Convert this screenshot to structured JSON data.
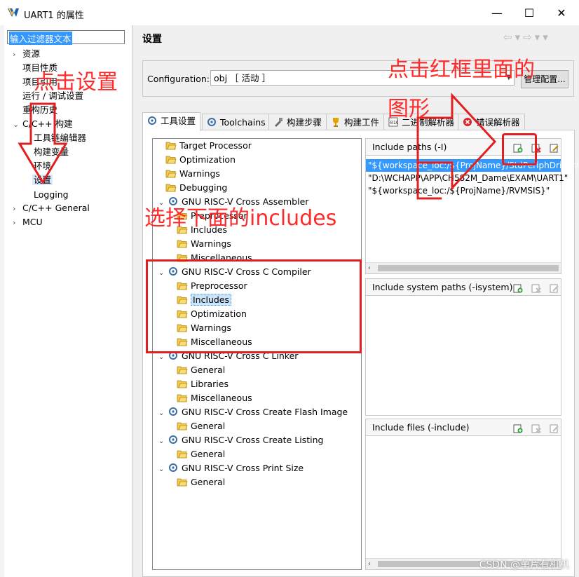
{
  "window": {
    "title": "UART1 的属性",
    "minimize": "—",
    "maximize": "☐",
    "close": "✕"
  },
  "filter": {
    "value": "输入过滤器文本"
  },
  "nav": [
    {
      "label": "资源",
      "arrow": "›"
    },
    {
      "label": "项目性质",
      "arrow": ""
    },
    {
      "label": "项目引用",
      "arrow": ""
    },
    {
      "label": "运行 / 调试设置",
      "arrow": ""
    },
    {
      "label": "重构历史",
      "arrow": ""
    },
    {
      "label": "C/C++ 构建",
      "arrow": "⌄"
    },
    {
      "label": "工具链编辑器",
      "arrow": ""
    },
    {
      "label": "构建变量",
      "arrow": ""
    },
    {
      "label": "环境",
      "arrow": ""
    },
    {
      "label": "设置",
      "arrow": ""
    },
    {
      "label": "Logging",
      "arrow": ""
    },
    {
      "label": "C/C++ General",
      "arrow": "›"
    },
    {
      "label": "MCU",
      "arrow": "›"
    }
  ],
  "header": {
    "title": "设置",
    "nav_arrows": "⇦▾⇨▾▾"
  },
  "config": {
    "label": "Configuration:",
    "value": "obj ［ 活动 ］",
    "manage_button": "管理配置..."
  },
  "tabs": [
    "工具设置",
    "Toolchains",
    "构建步骤",
    "构建工件",
    "二进制解析器",
    "错误解析器"
  ],
  "tree": [
    {
      "label": "Target Processor",
      "level": 1,
      "type": "folder"
    },
    {
      "label": "Optimization",
      "level": 1,
      "type": "folder"
    },
    {
      "label": "Warnings",
      "level": 1,
      "type": "folder"
    },
    {
      "label": "Debugging",
      "level": 1,
      "type": "folder"
    },
    {
      "label": "GNU RISC-V Cross Assembler",
      "level": 0,
      "type": "tool"
    },
    {
      "label": "Preprocessor",
      "level": 2,
      "type": "folder"
    },
    {
      "label": "Includes",
      "level": 2,
      "type": "folder"
    },
    {
      "label": "Warnings",
      "level": 2,
      "type": "folder"
    },
    {
      "label": "Miscellaneous",
      "level": 2,
      "type": "folder"
    },
    {
      "label": "GNU RISC-V Cross C Compiler",
      "level": 0,
      "type": "tool"
    },
    {
      "label": "Preprocessor",
      "level": 2,
      "type": "folder"
    },
    {
      "label": "Includes",
      "level": 2,
      "type": "folder",
      "selected": true
    },
    {
      "label": "Optimization",
      "level": 2,
      "type": "folder"
    },
    {
      "label": "Warnings",
      "level": 2,
      "type": "folder"
    },
    {
      "label": "Miscellaneous",
      "level": 2,
      "type": "folder"
    },
    {
      "label": "GNU RISC-V Cross C Linker",
      "level": 0,
      "type": "tool"
    },
    {
      "label": "General",
      "level": 2,
      "type": "folder"
    },
    {
      "label": "Libraries",
      "level": 2,
      "type": "folder"
    },
    {
      "label": "Miscellaneous",
      "level": 2,
      "type": "folder"
    },
    {
      "label": "GNU RISC-V Cross Create Flash Image",
      "level": 0,
      "type": "tool"
    },
    {
      "label": "General",
      "level": 2,
      "type": "folder"
    },
    {
      "label": "GNU RISC-V Cross Create Listing",
      "level": 0,
      "type": "tool"
    },
    {
      "label": "General",
      "level": 2,
      "type": "folder"
    },
    {
      "label": "GNU RISC-V Cross Print Size",
      "level": 0,
      "type": "tool"
    },
    {
      "label": "General",
      "level": 2,
      "type": "folder"
    }
  ],
  "panels": {
    "include_paths": {
      "title": "Include paths (-I)",
      "items": [
        "\"${workspace_loc:/${ProjName}/StdPeriphDriver/inc}\"",
        "\"D:\\WCHAPP\\APP\\CH582M_Dame\\EXAM\\UART1\"",
        "\"${workspace_loc:/${ProjName}/RVMSIS}\""
      ]
    },
    "include_system": {
      "title": "Include system paths (-isystem)"
    },
    "include_files": {
      "title": "Include files (-include)"
    }
  },
  "annotations": {
    "click_settings": "点击设置",
    "click_red_box_line1": "点击红框里面的",
    "click_red_box_line2": "图形",
    "select_includes": "选择下面的includes",
    "color": "#ff2a2a"
  },
  "watermark": "CSDN @单片有机机"
}
